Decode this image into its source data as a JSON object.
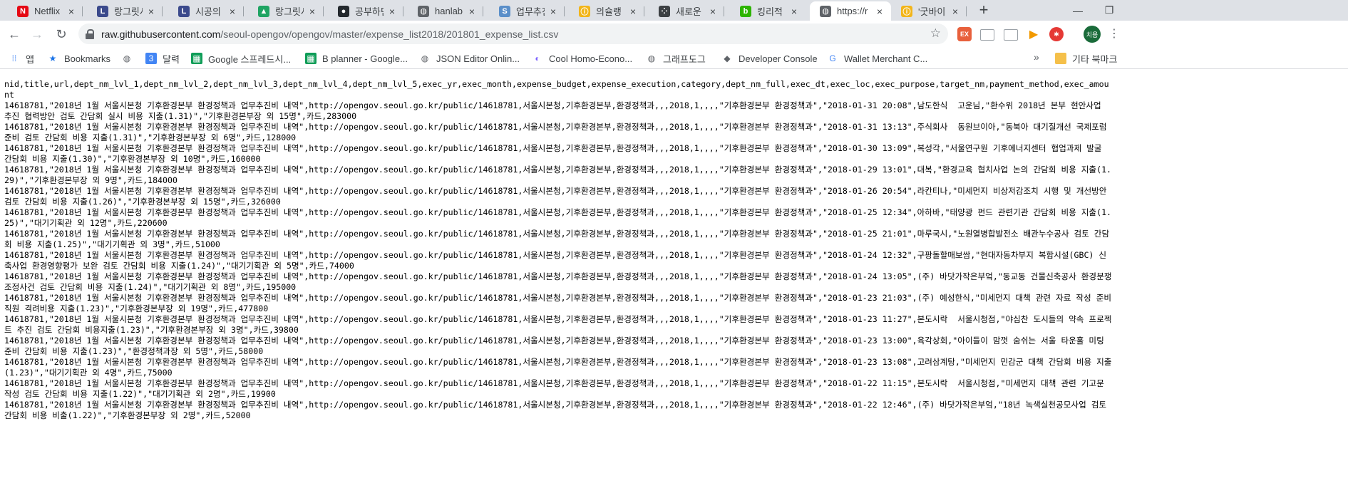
{
  "tabs": [
    {
      "title": "Netflix",
      "icon": "netflix-icon",
      "color": "#e50914",
      "glyph": "N"
    },
    {
      "title": "랑그릿사",
      "icon": "langrisser-icon",
      "color": "#3b4a8c",
      "glyph": "L"
    },
    {
      "title": "시공의 폭",
      "icon": "langrisser-icon",
      "color": "#3b4a8c",
      "glyph": "L"
    },
    {
      "title": "랑그릿사",
      "icon": "google-drive-icon",
      "color": "#1fa463",
      "glyph": "▲"
    },
    {
      "title": "공부하던",
      "icon": "github-icon",
      "color": "#24292e",
      "glyph": "●"
    },
    {
      "title": "hanlab.c",
      "icon": "globe-icon",
      "color": "#5f6368",
      "glyph": "◍"
    },
    {
      "title": "업무추진",
      "icon": "seoul-icon",
      "color": "#5b8fc9",
      "glyph": "S"
    },
    {
      "title": "의슐랭 가",
      "icon": "kakao-icon",
      "color": "#f2b51a",
      "glyph": "ⓘ"
    },
    {
      "title": "새로운 세",
      "icon": "dots-icon",
      "color": "#3c4043",
      "glyph": "⁘"
    },
    {
      "title": "킹리적 주",
      "icon": "naver-blog-icon",
      "color": "#2db400",
      "glyph": "b"
    },
    {
      "title": "https://r",
      "icon": "globe-icon",
      "color": "#5f6368",
      "glyph": "◍"
    },
    {
      "title": "'굿바이 :",
      "icon": "kakao-icon",
      "color": "#f2b51a",
      "glyph": "ⓘ"
    }
  ],
  "active_tab_index": 10,
  "toolbar": {
    "url_domain": "raw.githubusercontent.com",
    "url_path": "/seoul-opengov/opengov/master/expense_list2018/201801_expense_list.csv",
    "profile_initials": "치용"
  },
  "bookmarks": [
    {
      "label": "앱",
      "icon": "apps-grid-icon"
    },
    {
      "label": "Bookmarks",
      "icon": "star-icon"
    },
    {
      "label": "",
      "icon": "globe-icon"
    },
    {
      "label": "달력",
      "icon": "calendar-icon"
    },
    {
      "label": "Google 스프레드시...",
      "icon": "sheets-icon"
    },
    {
      "label": "B planner - Google...",
      "icon": "sheets-icon"
    },
    {
      "label": "JSON Editor Onlin...",
      "icon": "globe-icon"
    },
    {
      "label": "Cool Homo-Econo...",
      "icon": "cool-icon"
    },
    {
      "label": "그래프도그",
      "icon": "globe-icon"
    },
    {
      "label": "Developer Console",
      "icon": "devconsole-icon"
    },
    {
      "label": "Wallet Merchant C...",
      "icon": "google-icon"
    },
    {
      "label": "기타 북마크",
      "icon": "folder-icon"
    }
  ],
  "csv_lines": [
    "nid,title,url,dept_nm_lvl_1,dept_nm_lvl_2,dept_nm_lvl_3,dept_nm_lvl_4,dept_nm_lvl_5,exec_yr,exec_month,expense_budget,expense_execution,category,dept_nm_full,exec_dt,exec_loc,exec_purpose,target_nm,payment_method,exec_amount",
    "14618781,\"2018년 1월 서울시본청 기후환경본부 환경정책과 업무추진비 내역\",http://opengov.seoul.go.kr/public/14618781,서울시본청,기후환경본부,환경정책과,,,2018,1,,,,\"기후환경본부 환경정책과\",\"2018-01-31 20:08\",남도한식  고운님,\"환수위 2018년 본부 현안사업 추진 협력방안 검토 간담회 실시 비용 지출(1.31)\",\"기후환경본부장 외 15명\",카드,283000",
    "14618781,\"2018년 1월 서울시본청 기후환경본부 환경정책과 업무추진비 내역\",http://opengov.seoul.go.kr/public/14618781,서울시본청,기후환경본부,환경정책과,,,2018,1,,,,\"기후환경본부 환경정책과\",\"2018-01-31 13:13\",주식회사  동원브이아,\"동북아 대기질개선 국제포럼 준비 검토 간담회 비용 지출(1.31)\",\"기후환경본부장 외 6명\",카드,128000",
    "14618781,\"2018년 1월 서울시본청 기후환경본부 환경정책과 업무추진비 내역\",http://opengov.seoul.go.kr/public/14618781,서울시본청,기후환경본부,환경정책과,,,2018,1,,,,\"기후환경본부 환경정책과\",\"2018-01-30 13:09\",복성각,\"서울연구원 기후에너지센터 협업과제 발굴 간담회 비용 지출(1.30)\",\"기후환경본부장 외 10명\",카드,160000",
    "14618781,\"2018년 1월 서울시본청 기후환경본부 환경정책과 업무추진비 내역\",http://opengov.seoul.go.kr/public/14618781,서울시본청,기후환경본부,환경정책과,,,2018,1,,,,\"기후환경본부 환경정책과\",\"2018-01-29 13:01\",대복,\"환경교육 협치사업 논의 간담회 비용 지출(1.29)\",\"기후환경본부장 외 9명\",카드,184000",
    "14618781,\"2018년 1월 서울시본청 기후환경본부 환경정책과 업무추진비 내역\",http://opengov.seoul.go.kr/public/14618781,서울시본청,기후환경본부,환경정책과,,,2018,1,,,,\"기후환경본부 환경정책과\",\"2018-01-26 20:54\",라칸티나,\"미세먼지 비상저감조치 시행 및 개선방안 검토 간담회 비용 지출(1.26)\",\"기후환경본부장 외 15명\",카드,326000",
    "14618781,\"2018년 1월 서울시본청 기후환경본부 환경정책과 업무추진비 내역\",http://opengov.seoul.go.kr/public/14618781,서울시본청,기후환경본부,환경정책과,,,2018,1,,,,\"기후환경본부 환경정책과\",\"2018-01-25 12:34\",아하바,\"태양광 펀드 관련기관 간담회 비용 지출(1.25)\",\"대기기획관 외 12명\",카드,220600",
    "14618781,\"2018년 1월 서울시본청 기후환경본부 환경정책과 업무추진비 내역\",http://opengov.seoul.go.kr/public/14618781,서울시본청,기후환경본부,환경정책과,,,2018,1,,,,\"기후환경본부 환경정책과\",\"2018-01-25 21:01\",마루국시,\"노원열병합발전소 배관누수공사 검토 간담회 비용 지출(1.25)\",\"대기기획관 외 3명\",카드,51000",
    "14618781,\"2018년 1월 서울시본청 기후환경본부 환경정책과 업무추진비 내역\",http://opengov.seoul.go.kr/public/14618781,서울시본청,기후환경본부,환경정책과,,,2018,1,,,,\"기후환경본부 환경정책과\",\"2018-01-24 12:32\",구팡돌할매보쌈,\"현대자동차부지 복합시설(GBC) 신축사업 환경영향평가 보완 검토 간담회 비용 지출(1.24)\",\"대기기획관 외 5명\",카드,74000",
    "14618781,\"2018년 1월 서울시본청 기후환경본부 환경정책과 업무추진비 내역\",http://opengov.seoul.go.kr/public/14618781,서울시본청,기후환경본부,환경정책과,,,2018,1,,,,\"기후환경본부 환경정책과\",\"2018-01-24 13:05\",(주) 바닷가작은부엌,\"동교동 건물신축공사 환경분쟁조정사건 검토 간담회 비용 지출(1.24)\",\"대기기획관 외 8명\",카드,195000",
    "14618781,\"2018년 1월 서울시본청 기후환경본부 환경정책과 업무추진비 내역\",http://opengov.seoul.go.kr/public/14618781,서울시본청,기후환경본부,환경정책과,,,2018,1,,,,\"기후환경본부 환경정책과\",\"2018-01-23 21:03\",(주) 예성한식,\"미세먼지 대책 관련 자료 작성 준비 직원 격려비용 지출(1.23)\",\"기후환경본부장 외 19명\",카드,477800",
    "14618781,\"2018년 1월 서울시본청 기후환경본부 환경정책과 업무추진비 내역\",http://opengov.seoul.go.kr/public/14618781,서울시본청,기후환경본부,환경정책과,,,2018,1,,,,\"기후환경본부 환경정책과\",\"2018-01-23 11:27\",본도시락  서울시청점,\"야심찬 도시들의 약속 프로젝트 추진 검토 간담회 비용지출(1.23)\",\"기후환경본부장 외 3명\",카드,39800",
    "14618781,\"2018년 1월 서울시본청 기후환경본부 환경정책과 업무추진비 내역\",http://opengov.seoul.go.kr/public/14618781,서울시본청,기후환경본부,환경정책과,,,2018,1,,,,\"기후환경본부 환경정책과\",\"2018-01-23 13:00\",육각상회,\"아이들이 맘껏 숨쉬는 서울 타운홀 미팅 준비 간담회 비용 지출(1.23)\",\"환경정책과장 외 5명\",카드,58000",
    "14618781,\"2018년 1월 서울시본청 기후환경본부 환경정책과 업무추진비 내역\",http://opengov.seoul.go.kr/public/14618781,서울시본청,기후환경본부,환경정책과,,,2018,1,,,,\"기후환경본부 환경정책과\",\"2018-01-23 13:08\",고려삼계탕,\"미세먼지 민감군 대책 간담회 비용 지출(1.23)\",\"대기기획관 외 4명\",카드,75000",
    "14618781,\"2018년 1월 서울시본청 기후환경본부 환경정책과 업무추진비 내역\",http://opengov.seoul.go.kr/public/14618781,서울시본청,기후환경본부,환경정책과,,,2018,1,,,,\"기후환경본부 환경정책과\",\"2018-01-22 11:15\",본도시락  서울시청점,\"미세먼지 대책 관련 기고문 작성 검토 간담회 비용 지출(1.22)\",\"대기기획관 외 2명\",카드,19900",
    "14618781,\"2018년 1월 서울시본청 기후환경본부 환경정책과 업무추진비 내역\",http://opengov.seoul.go.kr/public/14618781,서울시본청,기후환경본부,환경정책과,,,2018,1,,,,\"기후환경본부 환경정책과\",\"2018-01-22 12:46\",(주) 바닷가작은부엌,\"18년 녹색실천공모사업 검토 간담회 비용 비출(1.22)\",\"기후환경본부장 외 2명\",카드,52000"
  ]
}
